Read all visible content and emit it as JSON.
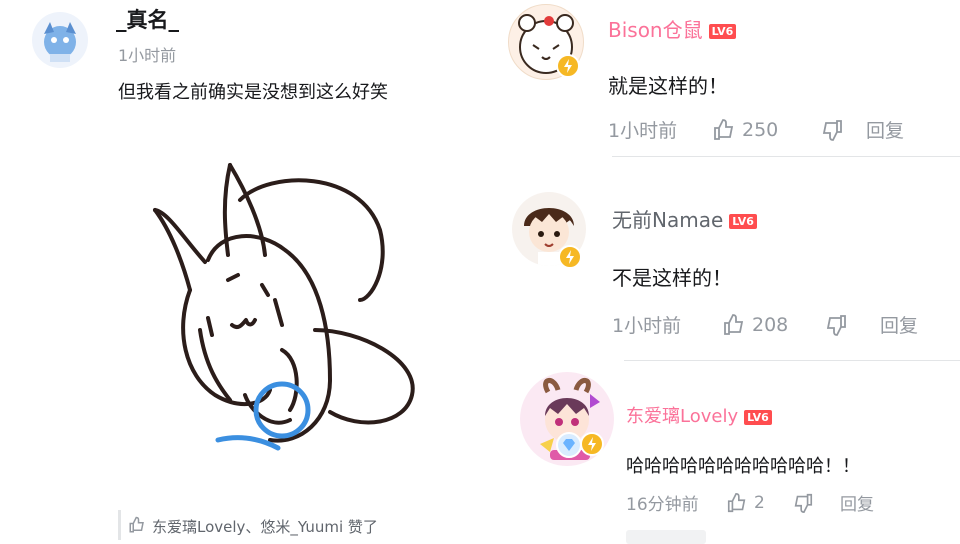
{
  "left_comment": {
    "username": "_真名_",
    "time": "1小时前",
    "text": "但我看之前确实是没想到这么好笑",
    "liked_by": "东爱璃Lovely、悠米_Yuumi 赞了"
  },
  "replies": [
    {
      "username": "Bison仓鼠",
      "level": "LV6",
      "text": "就是这样的！",
      "time": "1小时前",
      "likes": "250",
      "reply_label": "回复",
      "username_color": "#fb7299"
    },
    {
      "username": "无前Namae",
      "level": "LV6",
      "text": "不是这样的！",
      "time": "1小时前",
      "likes": "208",
      "reply_label": "回复",
      "username_color": "#61666d"
    },
    {
      "username": "东爱璃Lovely",
      "level": "LV6",
      "text": "哈哈哈哈哈哈哈哈哈哈哈！！",
      "time": "16分钟前",
      "likes": "2",
      "reply_label": "回复",
      "username_color": "#fb7299"
    }
  ],
  "colors": {
    "accent": "#fb7299",
    "level_badge": "#ff4d4f",
    "meta": "#9499a0",
    "sketch_blue": "#3b8fe0"
  },
  "icons": [
    "thumbs-up-icon",
    "thumbs-down-icon",
    "verified-lightning-icon"
  ]
}
